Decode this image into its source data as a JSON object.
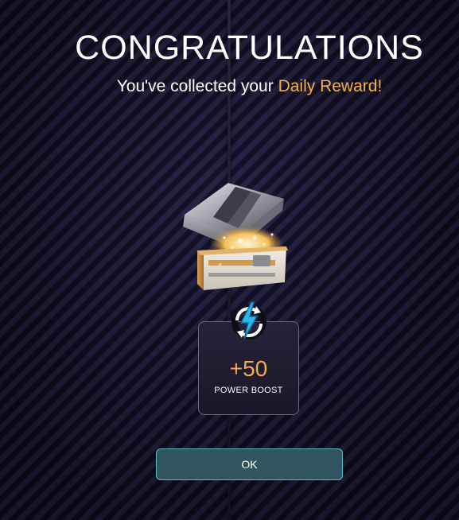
{
  "dialog": {
    "title": "CONGRATULATIONS",
    "subtitle_prefix": "You've collected your ",
    "subtitle_highlight": "Daily Reward!",
    "highlight_color": "#f5b04a"
  },
  "reward": {
    "chest_icon": "treasure-chest-icon",
    "boost_icon": "power-boost-icon",
    "amount": "+50",
    "label": "POWER BOOST",
    "amount_color": "#f3a94e"
  },
  "actions": {
    "ok_label": "OK",
    "ok_border_color": "#5fb6c6",
    "ok_bg_color": "#305560"
  }
}
